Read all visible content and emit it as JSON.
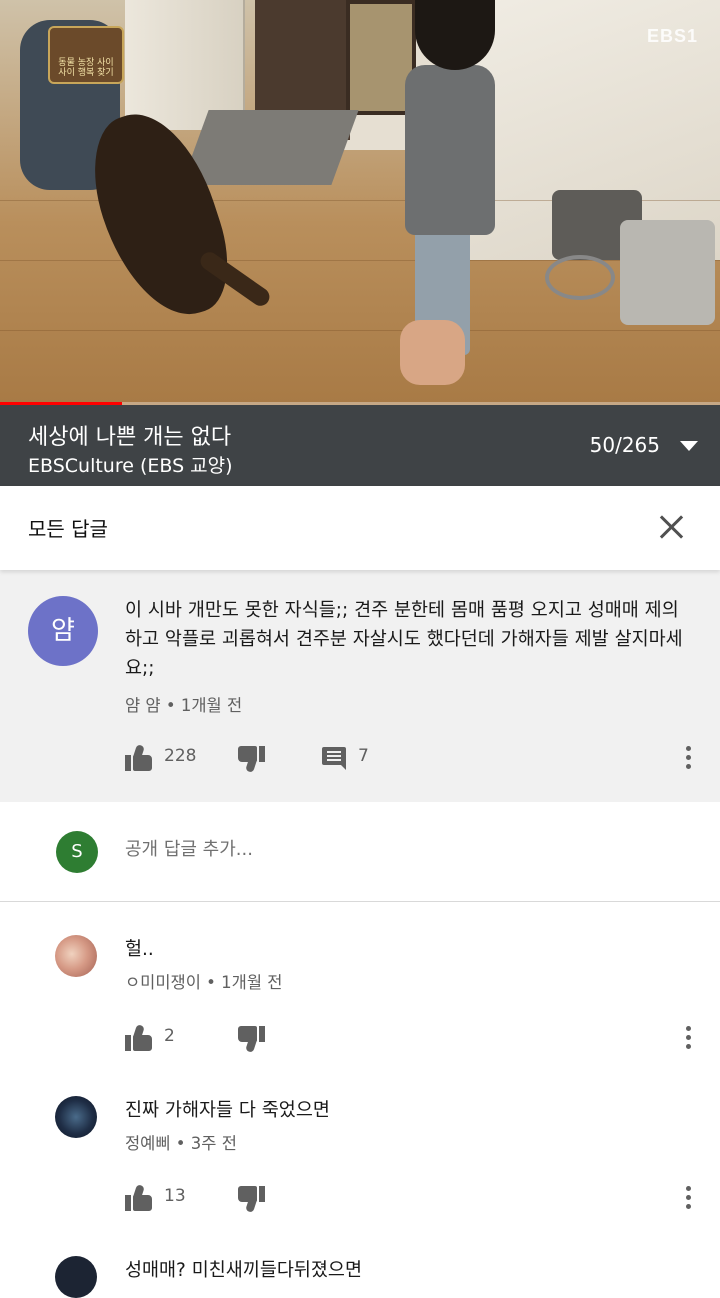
{
  "video": {
    "channel_logo": "EBS1",
    "badge_text": "동물 농장 사이\n사이 행복 찾기",
    "progress": 0.17
  },
  "playlist": {
    "title": "세상에 나쁜 개는 없다",
    "channel": "EBSCulture (EBS 교양)",
    "position": "50/265"
  },
  "replies_panel": {
    "title": "모든 답글"
  },
  "parent_comment": {
    "avatar_letter": "얌",
    "avatar_color": "#6d72c8",
    "text": "이 시바 개만도 못한 자식들;; 견주 분한테 몸매 품평 오지고 성매매 제의하고 악플로 괴롭혀서 견주분 자살시도 했다던데 가해자들 제발 살지마세요;;",
    "author": "얌 얌",
    "time": "1개월 전",
    "likes": "228",
    "reply_count": "7"
  },
  "add_reply": {
    "avatar_letter": "S",
    "avatar_color": "#2e7d32",
    "placeholder": "공개 답글 추가..."
  },
  "replies": [
    {
      "text": "헐..",
      "author": "ㅇ미미쟁이",
      "time": "1개월 전",
      "likes": "2"
    },
    {
      "text": "진짜 가해자들 다 죽었으면",
      "author": "정예삐",
      "time": "3주 전",
      "likes": "13"
    },
    {
      "text": "성매매? 미친새끼들다뒤졌으면"
    }
  ]
}
